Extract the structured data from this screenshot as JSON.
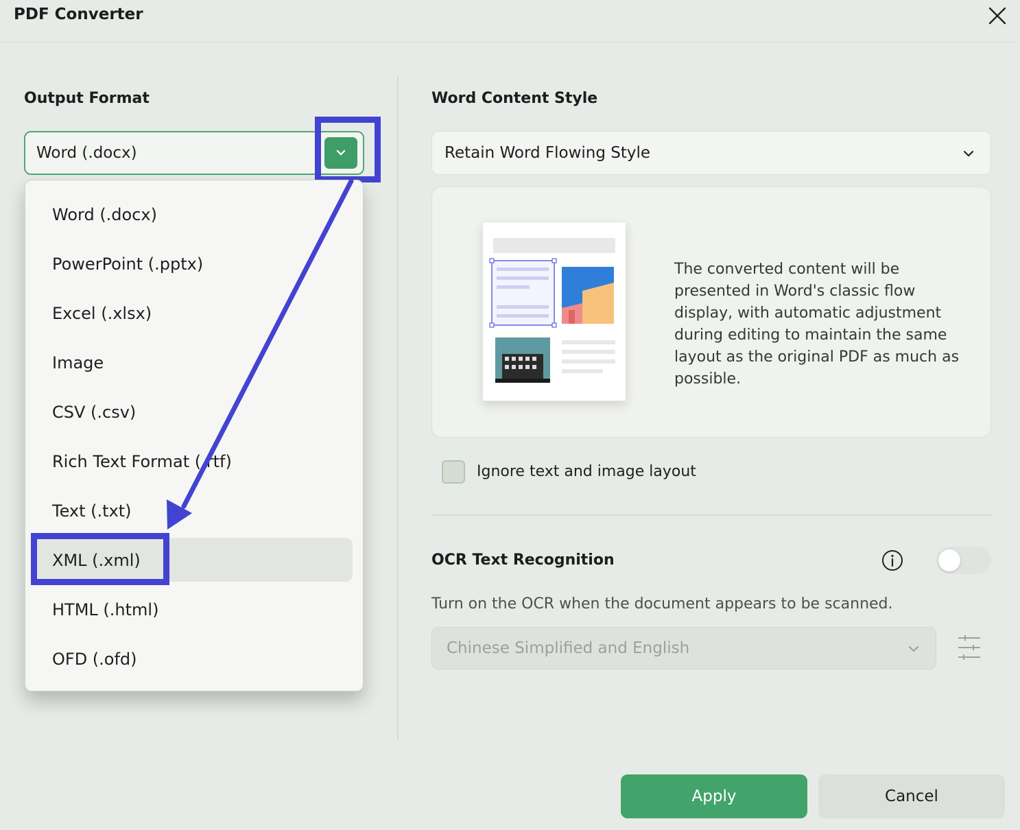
{
  "window": {
    "title": "PDF Converter"
  },
  "output_format": {
    "label": "Output Format",
    "selected": "Word (.docx)",
    "options": [
      "Word (.docx)",
      "PowerPoint (.pptx)",
      "Excel (.xlsx)",
      "Image",
      "CSV (.csv)",
      "Rich Text Format (.rtf)",
      "Text (.txt)",
      "XML (.xml)",
      "HTML (.html)",
      "OFD (.ofd)"
    ],
    "highlighted_option": "XML (.xml)"
  },
  "word_content_style": {
    "label": "Word Content Style",
    "selected": "Retain Word Flowing Style",
    "description": "The converted content will be presented in Word's classic flow display, with automatic adjustment during editing to maintain the same layout as the original PDF as much as possible."
  },
  "ignore_layout": {
    "label": "Ignore text and image layout",
    "checked": false
  },
  "ocr": {
    "title": "OCR Text Recognition",
    "enabled": false,
    "description": "Turn on the OCR when the document appears to be scanned.",
    "language": "Chinese Simplified and English"
  },
  "buttons": {
    "apply": "Apply",
    "cancel": "Cancel"
  },
  "colors": {
    "accent_green": "#42a36b",
    "annotation_blue": "#4343d2",
    "background": "#e7ebe7"
  },
  "icons": [
    "close-icon",
    "chevron-down-icon",
    "info-icon",
    "settings-sliders-icon"
  ]
}
